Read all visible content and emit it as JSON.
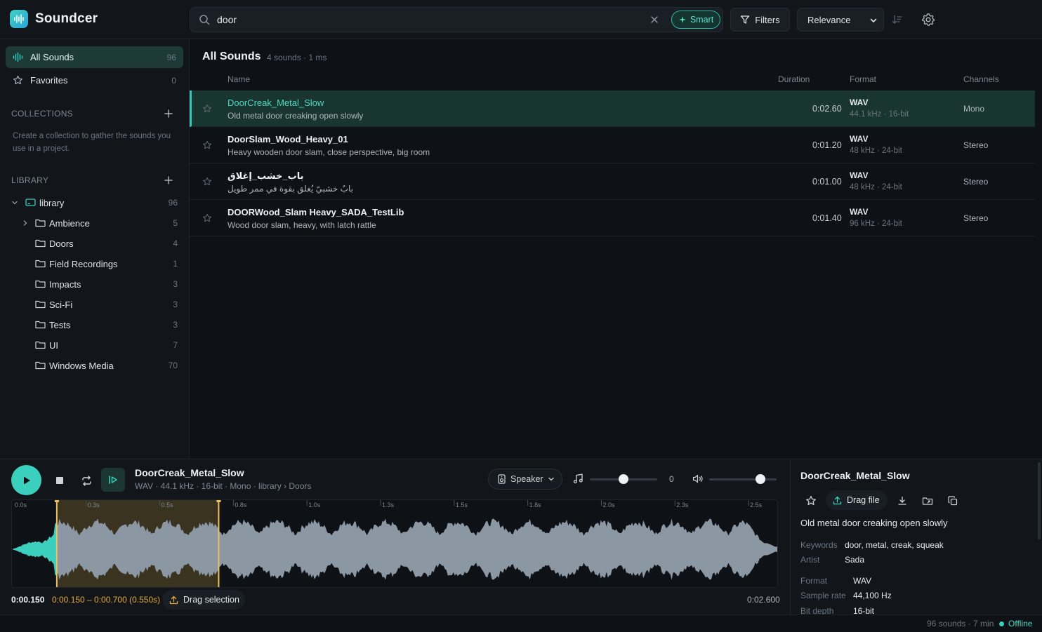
{
  "app": {
    "name": "Soundcer"
  },
  "search": {
    "value": "door",
    "smart_label": "Smart"
  },
  "toolbar": {
    "filters_label": "Filters",
    "sort_label": "Relevance"
  },
  "sidebar": {
    "all_sounds": {
      "label": "All Sounds",
      "count": "96"
    },
    "favorites": {
      "label": "Favorites",
      "count": "0"
    },
    "collections_title": "COLLECTIONS",
    "collections_hint": "Create a collection to gather the sounds you use in a project.",
    "library_title": "LIBRARY",
    "library_root": {
      "label": "library",
      "count": "96"
    },
    "folders": [
      {
        "label": "Ambience",
        "count": "5"
      },
      {
        "label": "Doors",
        "count": "4"
      },
      {
        "label": "Field Recordings",
        "count": "1"
      },
      {
        "label": "Impacts",
        "count": "3"
      },
      {
        "label": "Sci-Fi",
        "count": "3"
      },
      {
        "label": "Tests",
        "count": "3"
      },
      {
        "label": "UI",
        "count": "7"
      },
      {
        "label": "Windows Media",
        "count": "70"
      }
    ]
  },
  "main": {
    "title": "All Sounds",
    "subtitle": "4 sounds · 1 ms",
    "columns": {
      "name": "Name",
      "duration": "Duration",
      "format": "Format",
      "channels": "Channels"
    },
    "rows": [
      {
        "name": "DoorCreak_Metal_Slow",
        "desc": "Old metal door creaking open slowly",
        "duration": "0:02.60",
        "format": "WAV",
        "format_sub": "44.1 kHz · 16-bit",
        "channels": "Mono"
      },
      {
        "name": "DoorSlam_Wood_Heavy_01",
        "desc": "Heavy wooden door slam, close perspective, big room",
        "duration": "0:01.20",
        "format": "WAV",
        "format_sub": "48 kHz · 24-bit",
        "channels": "Stereo"
      },
      {
        "name": "باب_خشب_إغلاق",
        "desc": "بابٌ خشبيّ يُغلق بقوة في ممر طويل",
        "duration": "0:01.00",
        "format": "WAV",
        "format_sub": "48 kHz · 24-bit",
        "channels": "Stereo"
      },
      {
        "name": "DOORWood_Slam Heavy_SADA_TestLib",
        "desc": "Wood door slam, heavy, with latch rattle",
        "duration": "0:01.40",
        "format": "WAV",
        "format_sub": "96 kHz · 24-bit",
        "channels": "Stereo"
      }
    ]
  },
  "player": {
    "name": "DoorCreak_Metal_Slow",
    "meta": "WAV · 44.1 kHz · 16-bit · Mono · library › Doors",
    "output": "Speaker",
    "pitch_value": "0",
    "pitch_level": 0.5,
    "volume_level": 0.76,
    "ticks": [
      "0.0s",
      "0.3s",
      "0.5s",
      "0.8s",
      "1.0s",
      "1.3s",
      "1.5s",
      "1.8s",
      "2.0s",
      "2.3s",
      "2.5s"
    ],
    "current_time": "0:00.150",
    "selection": "0:00.150 – 0:00.700 (0.550s)",
    "drag_selection_label": "Drag selection",
    "end_time": "0:02.600",
    "selection_start_s": 0.15,
    "selection_end_s": 0.7,
    "duration_s": 2.6
  },
  "details": {
    "name": "DoorCreak_Metal_Slow",
    "drag_label": "Drag file",
    "description": "Old metal door creaking open slowly",
    "keywords_label": "Keywords",
    "keywords": "door, metal, creak, squeak",
    "artist_label": "Artist",
    "artist": "Sada",
    "format_label": "Format",
    "format": "WAV",
    "sample_rate_label": "Sample rate",
    "sample_rate": "44,100 Hz",
    "bit_depth_label": "Bit depth",
    "bit_depth": "16-bit"
  },
  "status": {
    "summary": "96 sounds · 7 min",
    "connection": "Offline"
  },
  "colors": {
    "accent": "#3ad0bd",
    "selection": "#e5a93c",
    "background": "#0f1216"
  }
}
